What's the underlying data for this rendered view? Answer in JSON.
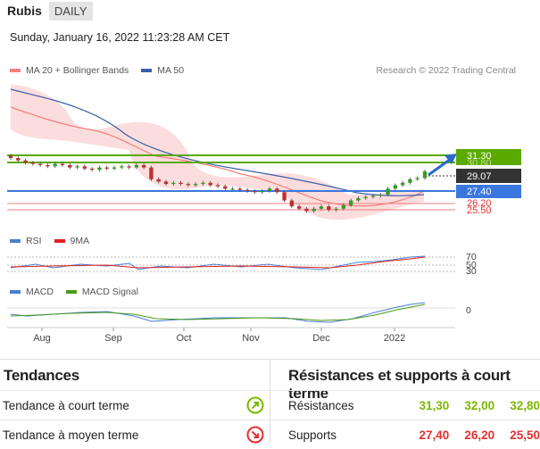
{
  "header": {
    "title": "Rubis",
    "period": "DAILY"
  },
  "datetime": "Sunday, January 16, 2022 11:23:28 AM CET",
  "research": "Research © 2022 Trading Central",
  "legend": {
    "price": [
      {
        "label": "MA 20 + Bollinger Bands",
        "color": "#f08080"
      },
      {
        "label": "MA 50",
        "color": "#3a5fa8"
      }
    ],
    "rsi": [
      {
        "label": "RSI",
        "color": "#4a7fd0"
      },
      {
        "label": "9MA",
        "color": "#e02020"
      }
    ],
    "macd": [
      {
        "label": "MACD",
        "color": "#4a7fd0"
      },
      {
        "label": "MACD Signal",
        "color": "#4a9a1a"
      }
    ]
  },
  "price_labels": {
    "r1": "31.30",
    "r2_hidden": "30.80",
    "last": "29.07",
    "s1": "27.40",
    "s2": "26.20",
    "s3": "25.50"
  },
  "rsi_ticks": [
    "70",
    "50",
    "30"
  ],
  "macd_tick": "0",
  "x_labels": [
    "Aug",
    "Sep",
    "Oct",
    "Nov",
    "Dec",
    "2022"
  ],
  "colors": {
    "green": "#5aaa00",
    "blue": "#3a78e0",
    "red": "#e53030",
    "dark": "#333333"
  },
  "chart_data": {
    "type": "candlestick",
    "price_approx": [
      30.2,
      30.0,
      29.8,
      29.7,
      29.6,
      29.5,
      29.7,
      29.6,
      29.4,
      29.5,
      29.3,
      29.2,
      29.4,
      29.3,
      29.4,
      29.5,
      29.4,
      29.6,
      29.4,
      28.4,
      28.2,
      28.0,
      28.1,
      28.0,
      27.9,
      28.0,
      28.1,
      27.9,
      27.8,
      27.6,
      27.6,
      27.5,
      27.4,
      27.3,
      27.4,
      27.6,
      27.3,
      26.6,
      26.1,
      25.9,
      25.7,
      25.9,
      26.1,
      25.8,
      25.9,
      26.2,
      26.6,
      26.8,
      26.9,
      27.0,
      27.1,
      27.6,
      27.9,
      28.1,
      28.4,
      28.5,
      29.07
    ],
    "resistances": [
      31.3,
      32.0,
      32.8
    ],
    "supports": [
      27.4,
      26.2,
      25.5
    ]
  },
  "tendances": {
    "title": "Tendances",
    "rows": [
      {
        "label": "Tendance à court terme",
        "icon": "arrow-up-right-icon",
        "color": "#7ab800"
      },
      {
        "label": "Tendance à moyen terme",
        "icon": "arrow-down-right-icon",
        "color": "#e53030"
      }
    ]
  },
  "rs": {
    "title": "Résistances et supports à court terme",
    "resistances_label": "Résistances",
    "supports_label": "Supports",
    "resistances": [
      "31,30",
      "32,00",
      "32,80"
    ],
    "supports": [
      "27,40",
      "26,20",
      "25,50"
    ]
  }
}
